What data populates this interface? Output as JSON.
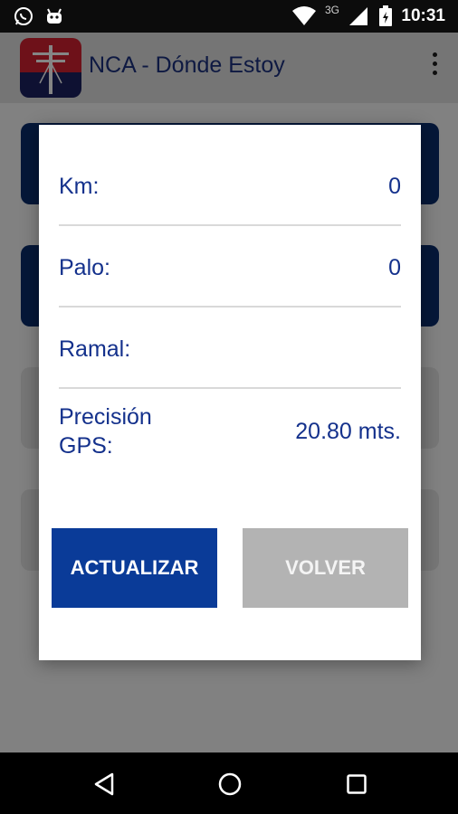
{
  "status_bar": {
    "time": "10:31",
    "network": "3G",
    "icons": [
      "whatsapp-icon",
      "android-icon",
      "wifi-icon",
      "signal-icon",
      "battery-icon"
    ]
  },
  "app_bar": {
    "title": "NCA - Dónde Estoy",
    "menu_icon": "more-vert-icon"
  },
  "dialog": {
    "rows": [
      {
        "label": "Km:",
        "value": "0"
      },
      {
        "label": "Palo:",
        "value": "0"
      },
      {
        "label": "Ramal:",
        "value": ""
      },
      {
        "label_line1": "Precisión",
        "label_line2": "GPS:",
        "value": "20.80 mts."
      }
    ],
    "buttons": {
      "update": "ACTUALIZAR",
      "back": "VOLVER"
    }
  },
  "nav_bar": {
    "icons": [
      "back-icon",
      "home-icon",
      "recents-icon"
    ]
  },
  "colors": {
    "primary": "#0a3b98",
    "text_blue": "#14318c",
    "disabled": "#b3b3b3"
  }
}
